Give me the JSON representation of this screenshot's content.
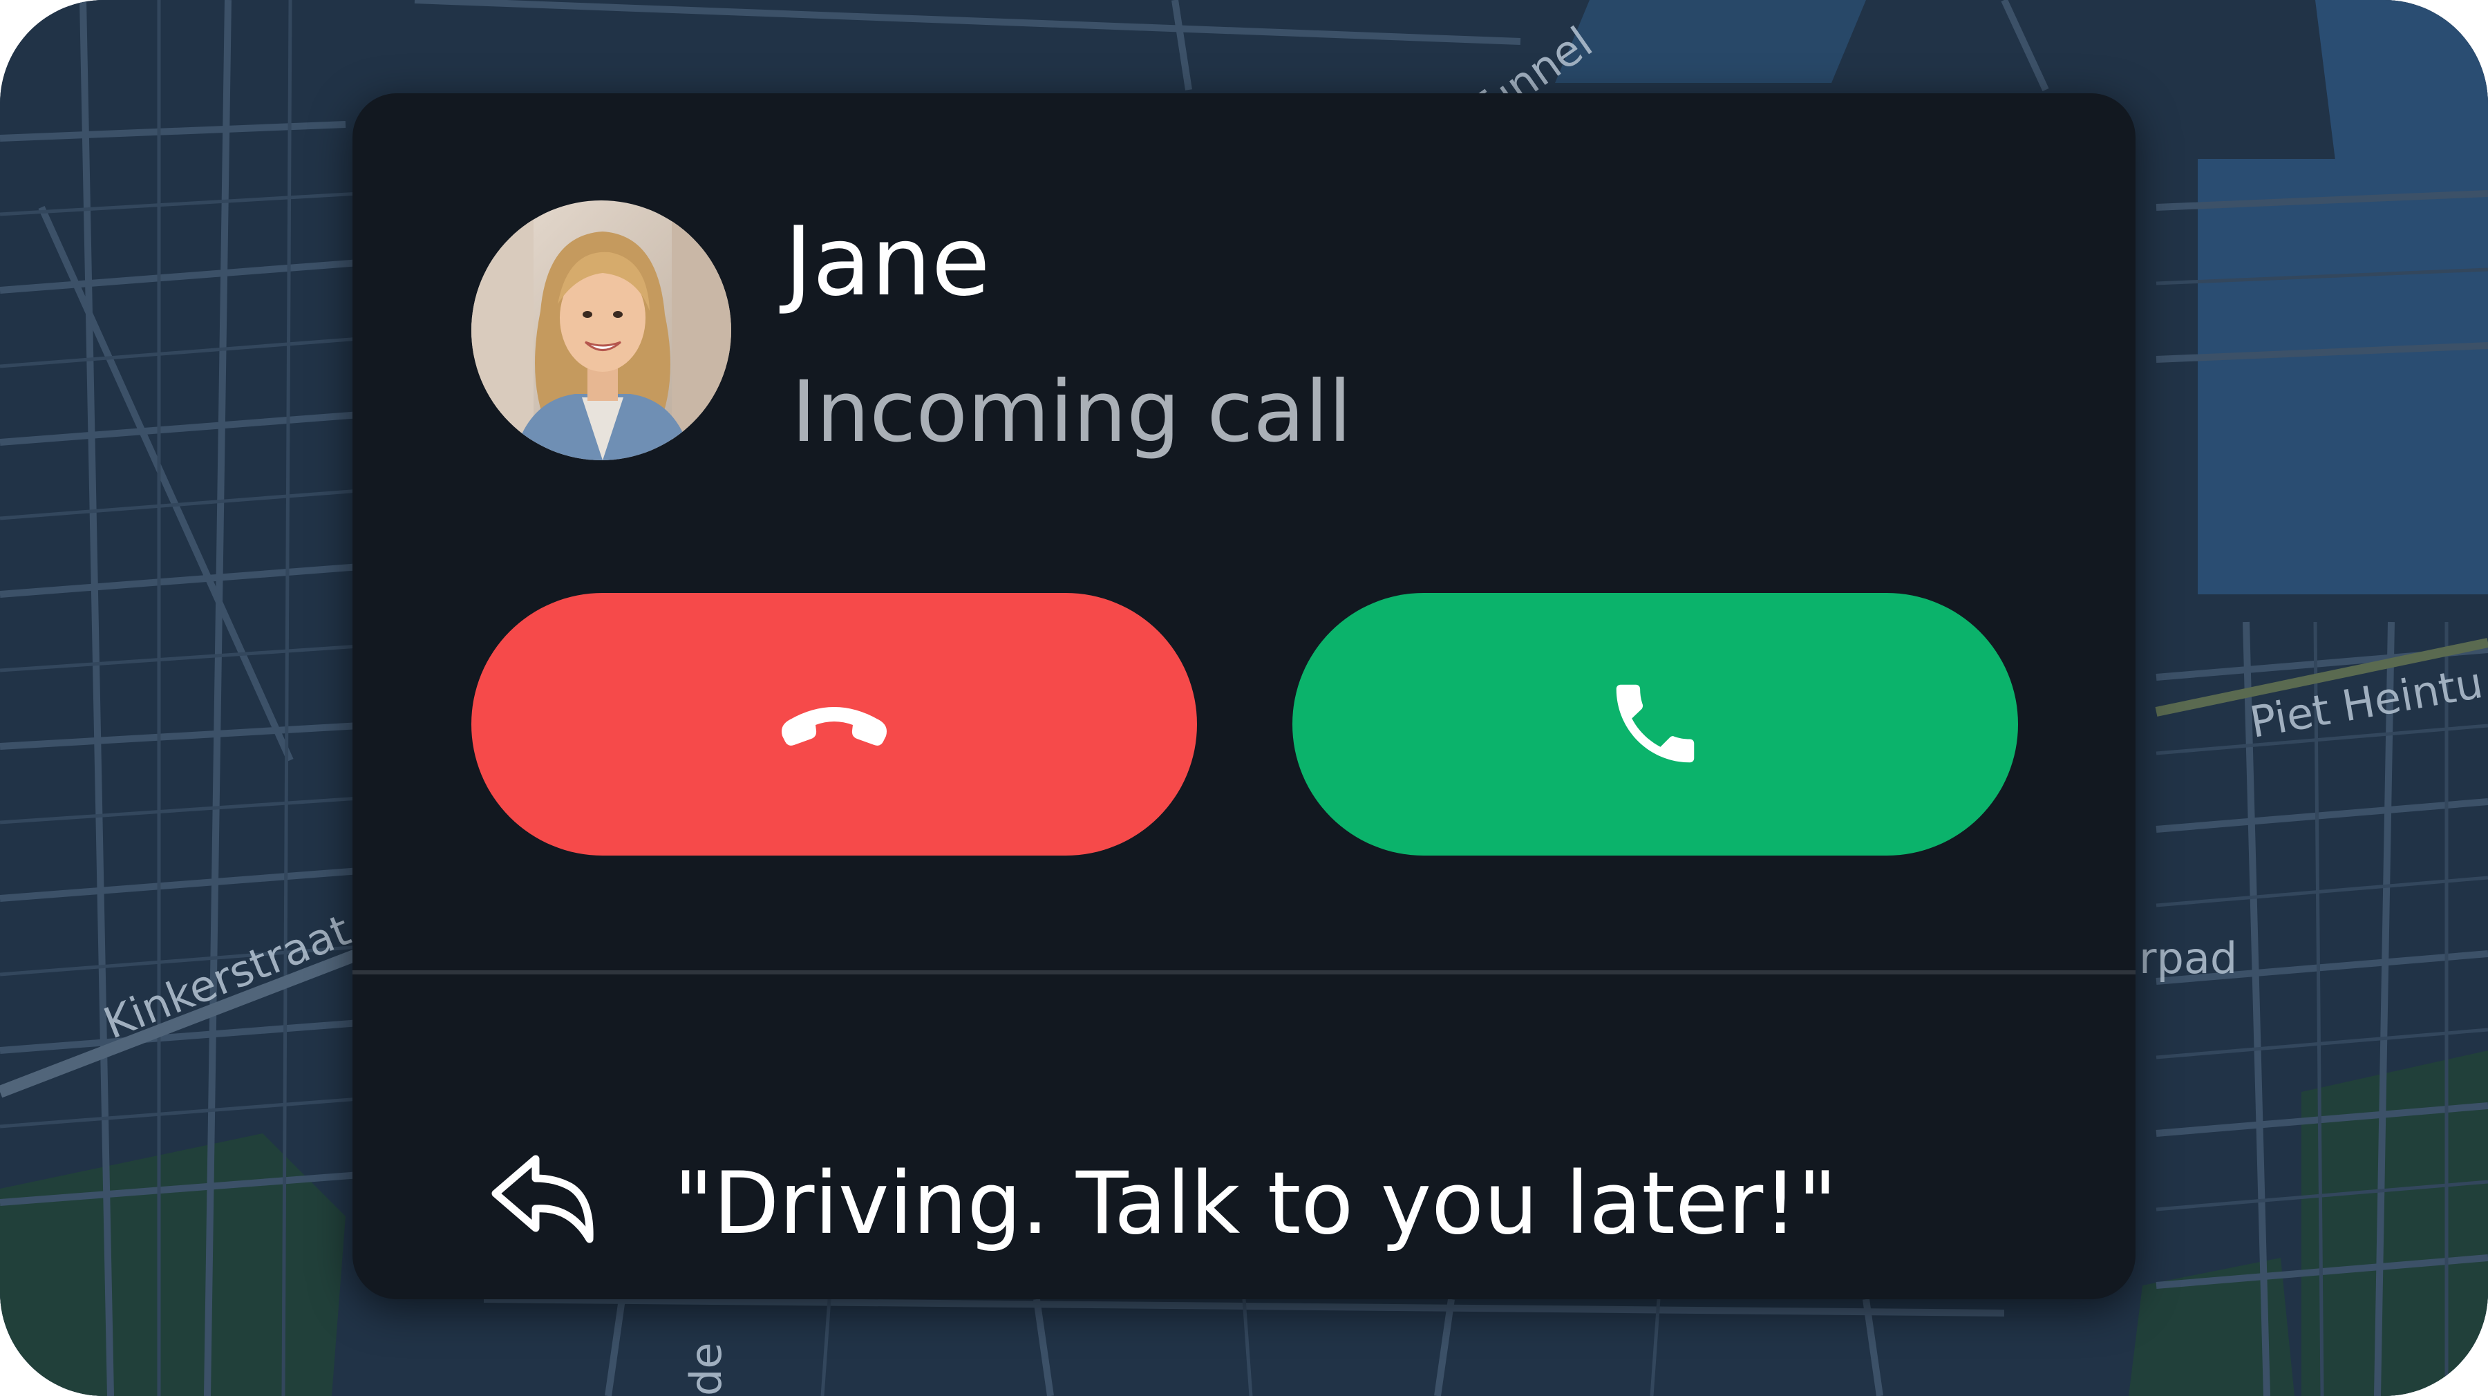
{
  "caller": {
    "name": "Jane",
    "status": "Incoming call"
  },
  "actions": {
    "decline_icon": "phone-hangup-icon",
    "accept_icon": "phone-icon",
    "decline_color": "#f64a4a",
    "accept_color": "#0bb36b"
  },
  "quick_reply": {
    "icon": "reply-arrow-icon",
    "message": "\"Driving. Talk to you later!\""
  },
  "map": {
    "labels": [
      "Kinkerstraat",
      "Piet Heintu",
      "Tunnel",
      "rpad",
      "de"
    ]
  },
  "colors": {
    "card_background": "#121820",
    "map_background": "#213347"
  }
}
